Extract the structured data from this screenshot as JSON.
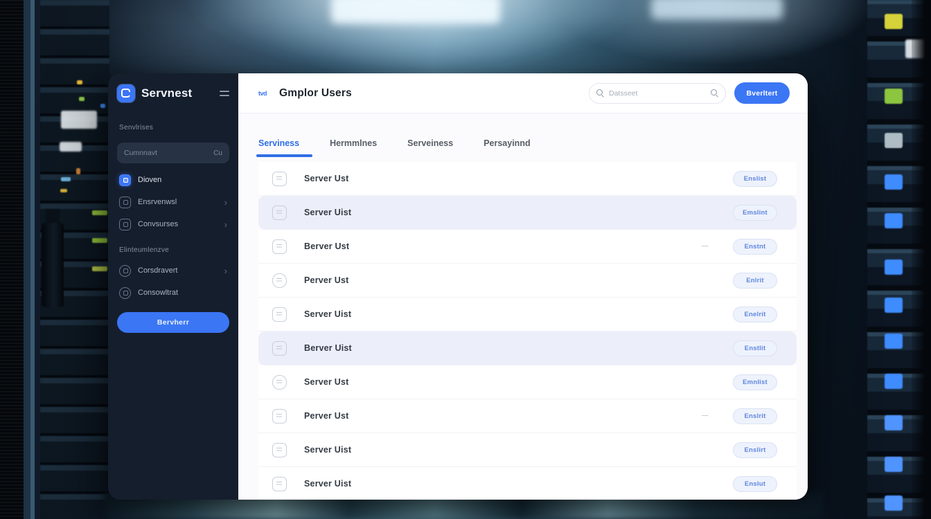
{
  "colors": {
    "accent_blue": "#3b76f5",
    "sidebar_bg": "#151e2c",
    "highlight_row": "#eceef9",
    "action_text": "#5f87de"
  },
  "sidebar": {
    "logo_text": "Servnest",
    "section1": "Senvlrises",
    "search": {
      "placeholder": "Cumnnavt",
      "hint": "Cu"
    },
    "items": [
      {
        "label": "Dioven"
      },
      {
        "label": "Ensrvenwsl"
      },
      {
        "label": "Convsurses"
      },
      {
        "label": "Corsdravert"
      },
      {
        "label": "Consowltrat"
      }
    ],
    "section2": "Elinteumlenzve",
    "button_label": "Bervherr"
  },
  "header": {
    "glyph": "tvd",
    "title": "Gmplor Users",
    "search_placeholder": "Datsseet",
    "button_label": "Bverltert"
  },
  "tabs": [
    {
      "label": "Serviness"
    },
    {
      "label": "Hermmlnes"
    },
    {
      "label": "Serveiness"
    },
    {
      "label": "Persayinnd"
    }
  ],
  "list": {
    "rows": [
      {
        "name": "Server Ust",
        "action": "Enslist",
        "note": ""
      },
      {
        "name": "Server Uist",
        "action": "Emslint",
        "note": ""
      },
      {
        "name": "Berver Ust",
        "action": "Enstnt",
        "note": "~~"
      },
      {
        "name": "Perver Ust",
        "action": "Enlrit",
        "note": ""
      },
      {
        "name": "Server Uist",
        "action": "Enelrit",
        "note": ""
      },
      {
        "name": "Berver Uist",
        "action": "Enstlit",
        "note": ""
      },
      {
        "name": "Server Ust",
        "action": "Emnlist",
        "note": ""
      },
      {
        "name": "Perver Ust",
        "action": "Enslrit",
        "note": "~~"
      },
      {
        "name": "Server Uist",
        "action": "Enslirt",
        "note": ""
      },
      {
        "name": "Server Uist",
        "action": "Enslut",
        "note": ""
      }
    ]
  }
}
